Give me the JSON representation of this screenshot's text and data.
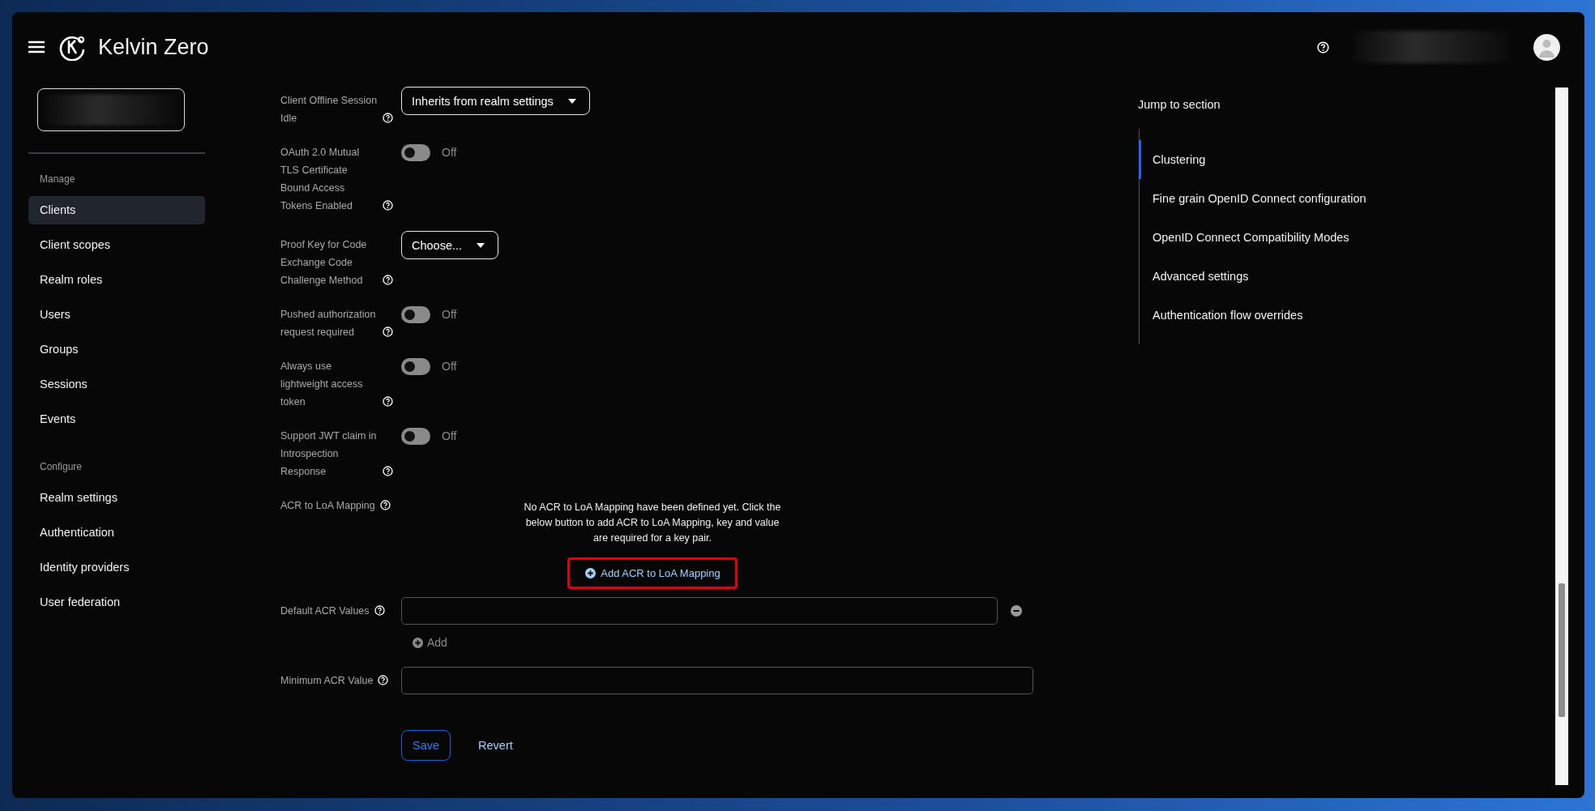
{
  "header": {
    "brand": "Kelvin Zero"
  },
  "sidebar": {
    "sections": [
      {
        "title": "Manage",
        "items": [
          {
            "label": "Clients",
            "selected": true
          },
          {
            "label": "Client scopes",
            "selected": false
          },
          {
            "label": "Realm roles",
            "selected": false
          },
          {
            "label": "Users",
            "selected": false
          },
          {
            "label": "Groups",
            "selected": false
          },
          {
            "label": "Sessions",
            "selected": false
          },
          {
            "label": "Events",
            "selected": false
          }
        ]
      },
      {
        "title": "Configure",
        "items": [
          {
            "label": "Realm settings",
            "selected": false
          },
          {
            "label": "Authentication",
            "selected": false
          },
          {
            "label": "Identity providers",
            "selected": false
          },
          {
            "label": "User federation",
            "selected": false
          }
        ]
      }
    ]
  },
  "form": {
    "rows": [
      {
        "kind": "select",
        "label": "Client Offline Session Idle",
        "value": "Inherits from realm settings"
      },
      {
        "kind": "toggle",
        "label": "OAuth 2.0 Mutual TLS Certificate Bound Access Tokens Enabled",
        "on": false,
        "state_label": "Off"
      },
      {
        "kind": "select",
        "label": "Proof Key for Code Exchange Code Challenge Method",
        "value": "Choose..."
      },
      {
        "kind": "toggle",
        "label": "Pushed authorization request required",
        "on": false,
        "state_label": "Off"
      },
      {
        "kind": "toggle",
        "label": "Always use lightweight access token",
        "on": false,
        "state_label": "Off"
      },
      {
        "kind": "toggle",
        "label": "Support JWT claim in Introspection Response",
        "on": false,
        "state_label": "Off"
      },
      {
        "kind": "mapping",
        "label": "ACR to LoA Mapping",
        "message": "No ACR to LoA Mapping have been defined yet. Click the below button to add ACR to LoA Mapping, key and value are required for a key pair.",
        "button": "Add ACR to LoA Mapping",
        "highlighted": true
      },
      {
        "kind": "multi",
        "label": "Default ACR Values",
        "add": "Add"
      },
      {
        "kind": "input",
        "label": "Minimum ACR Value"
      }
    ],
    "actions": {
      "save": "Save",
      "revert": "Revert"
    }
  },
  "jump": {
    "title": "Jump to section",
    "items": [
      {
        "label": "Clustering",
        "selected": true
      },
      {
        "label": "Fine grain OpenID Connect configuration",
        "selected": false
      },
      {
        "label": "OpenID Connect Compatibility Modes",
        "selected": false
      },
      {
        "label": "Advanced settings",
        "selected": false
      },
      {
        "label": "Authentication flow overrides",
        "selected": false
      }
    ]
  }
}
